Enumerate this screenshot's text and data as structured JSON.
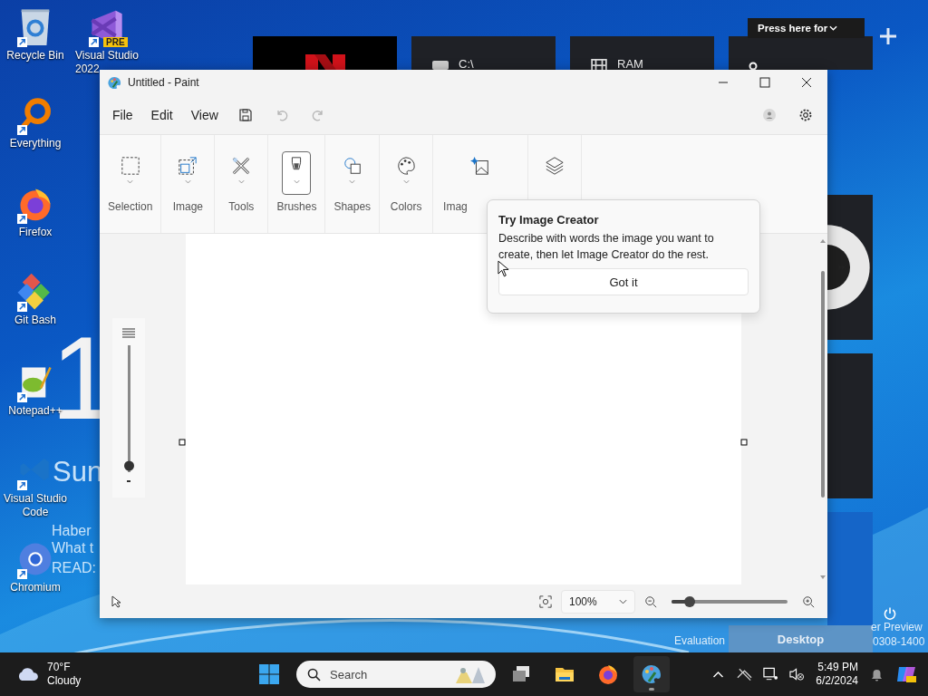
{
  "desktop_icons": [
    {
      "label": "Recycle Bin"
    },
    {
      "label": "Visual Studio 2022",
      "badge": "PRE"
    },
    {
      "label": "Everything"
    },
    {
      "label": "Firefox"
    },
    {
      "label": "Git Bash"
    },
    {
      "label": "Notepad++"
    },
    {
      "label": "Visual Studio Code"
    },
    {
      "label": "Chromium"
    }
  ],
  "wallpaper_texts": [
    "1",
    "Sun",
    "Haber",
    "What t",
    "READ:"
  ],
  "tiles": [
    {
      "label": "C:\\"
    },
    {
      "label": "RAM"
    }
  ],
  "tile_tip": "Press here for",
  "paint": {
    "title": "Untitled - Paint",
    "menu": [
      "File",
      "Edit",
      "View"
    ],
    "undo": {
      "disabled": true
    },
    "redo": {
      "disabled": true
    },
    "tools": [
      {
        "label": "Selection",
        "selected": false
      },
      {
        "label": "Image",
        "selected": false
      },
      {
        "label": "Tools",
        "selected": false
      },
      {
        "label": "Brushes",
        "selected": true
      },
      {
        "label": "Shapes",
        "selected": false
      },
      {
        "label": "Colors",
        "selected": false
      },
      {
        "label": "Imag",
        "selected": false
      }
    ],
    "brush_size": {
      "level": 0.05
    },
    "popup": {
      "title": "Try Image Creator",
      "text": "Describe with words the image you want to create, then let Image Creator do the rest.",
      "button": "Got it"
    },
    "zoom": {
      "value": "100%",
      "level": 0.16
    }
  },
  "footer_texts": [
    "Evaluation",
    "Desktop",
    "er Preview",
    "0308-1400"
  ],
  "taskbar": {
    "temperature": "70°F",
    "condition": "Cloudy",
    "search_placeholder": "Search",
    "apps": [
      {
        "selected": false
      },
      {
        "selected": false
      },
      {
        "selected": false
      },
      {
        "selected": true
      }
    ],
    "time": "5:49 PM",
    "date": "6/2/2024"
  }
}
